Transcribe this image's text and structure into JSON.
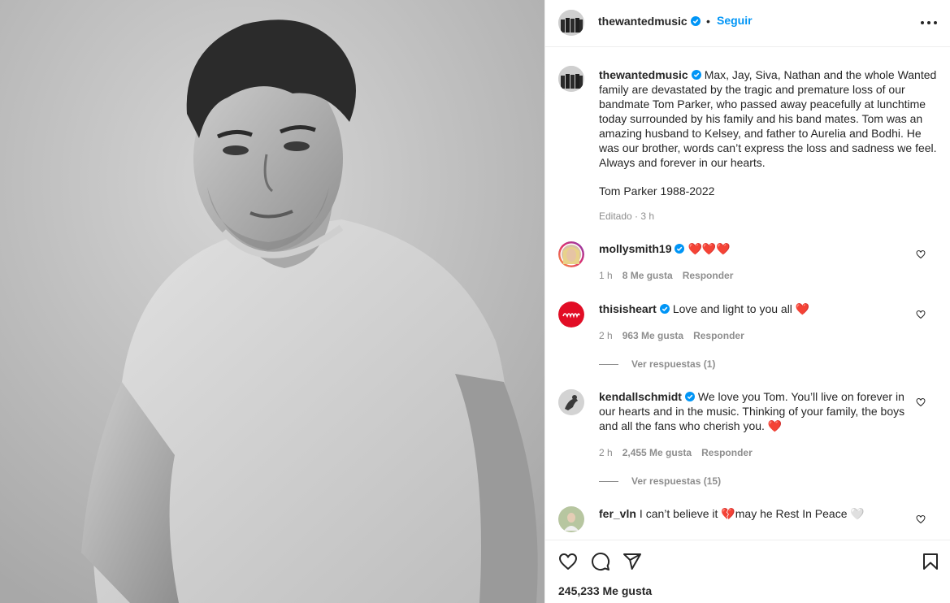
{
  "header": {
    "username": "thewantedmusic",
    "separator": "•",
    "follow_label": "Seguir"
  },
  "caption": {
    "username": "thewantedmusic",
    "text": "Max, Jay, Siva, Nathan and the whole Wanted family are devastated by the tragic and premature loss of our bandmate Tom Parker, who passed away peacefully at lunchtime today surrounded by his family and his band mates. Tom was an amazing husband to Kelsey, and father to Aurelia and Bodhi. He was our brother, words can’t express the loss and sadness we feel. Always and forever in our hearts.",
    "signature": "Tom Parker 1988-2022",
    "meta": "Editado · 3 h"
  },
  "comments": [
    {
      "username": "mollysmith19",
      "verified": true,
      "text": "❤️❤️❤️",
      "time": "1 h",
      "likes": "8 Me gusta",
      "reply_label": "Responder"
    },
    {
      "username": "thisisheart",
      "verified": true,
      "text": "Love and light to you all ❤️",
      "time": "2 h",
      "likes": "963 Me gusta",
      "reply_label": "Responder",
      "view_replies": "Ver respuestas (1)"
    },
    {
      "username": "kendallschmidt",
      "verified": true,
      "text": "We love you Tom. You’ll live on forever in our hearts and in the music. Thinking of your family, the boys and all the fans who cherish you. ❤️",
      "time": "2 h",
      "likes": "2,455 Me gusta",
      "reply_label": "Responder",
      "view_replies": "Ver respuestas (15)"
    },
    {
      "username": "fer_vln",
      "verified": false,
      "text": "I can’t believe it 💔may he Rest In Peace 🤍"
    }
  ],
  "actions": {
    "icons": [
      "heart-icon",
      "comment-icon",
      "share-icon",
      "bookmark-icon"
    ],
    "likes_count": "245,233 Me gusta"
  },
  "colors": {
    "accent": "#0095f6",
    "verified": "#0095f6",
    "muted_text": "#8e8e8e",
    "border": "#efefef"
  }
}
